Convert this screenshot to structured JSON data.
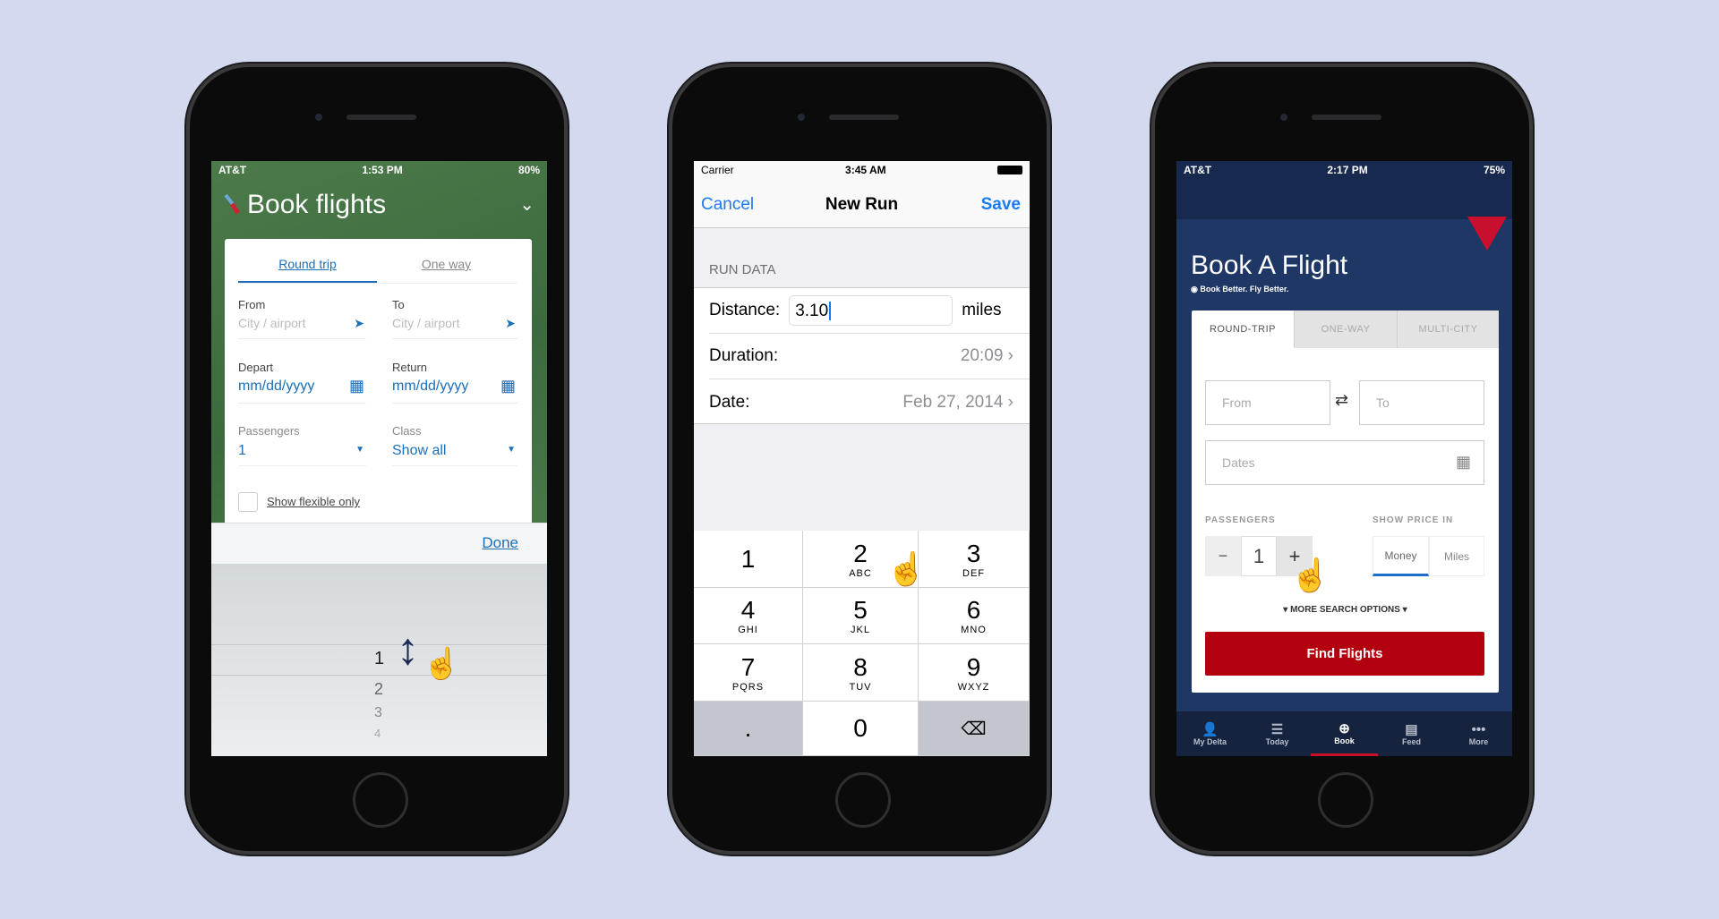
{
  "phone1": {
    "status": {
      "carrier": "AT&T",
      "time": "1:53 PM",
      "battery": "80%"
    },
    "title": "Book flights",
    "tabs": [
      {
        "label": "Round trip",
        "active": true
      },
      {
        "label": "One way",
        "active": false
      }
    ],
    "from": {
      "label": "From",
      "placeholder": "City / airport"
    },
    "to": {
      "label": "To",
      "placeholder": "City / airport"
    },
    "depart": {
      "label": "Depart",
      "value": "mm/dd/yyyy"
    },
    "return": {
      "label": "Return",
      "value": "mm/dd/yyyy"
    },
    "passengers": {
      "label": "Passengers",
      "value": "1"
    },
    "class": {
      "label": "Class",
      "value": "Show all"
    },
    "flexible": {
      "label": "Show flexible only",
      "checked": false
    },
    "done": "Done",
    "picker": [
      "1",
      "2",
      "3",
      "4"
    ]
  },
  "phone2": {
    "status": {
      "carrier": "Carrier",
      "time": "3:45 AM"
    },
    "nav": {
      "cancel": "Cancel",
      "title": "New Run",
      "save": "Save"
    },
    "section": "RUN DATA",
    "distance": {
      "label": "Distance:",
      "value": "3.10",
      "unit": "miles"
    },
    "duration": {
      "label": "Duration:",
      "value": "20:09"
    },
    "date": {
      "label": "Date:",
      "value": "Feb 27, 2014"
    },
    "keys": [
      {
        "n": "1",
        "l": ""
      },
      {
        "n": "2",
        "l": "ABC"
      },
      {
        "n": "3",
        "l": "DEF"
      },
      {
        "n": "4",
        "l": "GHI"
      },
      {
        "n": "5",
        "l": "JKL"
      },
      {
        "n": "6",
        "l": "MNO"
      },
      {
        "n": "7",
        "l": "PQRS"
      },
      {
        "n": "8",
        "l": "TUV"
      },
      {
        "n": "9",
        "l": "WXYZ"
      },
      {
        "n": ".",
        "l": ""
      },
      {
        "n": "0",
        "l": ""
      },
      {
        "n": "⌫",
        "l": ""
      }
    ]
  },
  "phone3": {
    "status": {
      "carrier": "AT&T",
      "time": "2:17 PM",
      "battery": "75%"
    },
    "title": "Book A Flight",
    "tagline": "Book Better. Fly Better.",
    "tabs": [
      {
        "label": "ROUND-TRIP",
        "active": true
      },
      {
        "label": "ONE-WAY",
        "active": false
      },
      {
        "label": "MULTI-CITY",
        "active": false
      }
    ],
    "from": "From",
    "to": "To",
    "dates": "Dates",
    "passengers": {
      "label": "PASSENGERS",
      "minus": "−",
      "value": "1",
      "plus": "+"
    },
    "price": {
      "label": "SHOW PRICE IN",
      "options": [
        "Money",
        "Miles"
      ],
      "selected": "Money"
    },
    "more": "▾ MORE SEARCH OPTIONS ▾",
    "find": "Find Flights",
    "nav": [
      {
        "label": "My Delta",
        "icon": "👤"
      },
      {
        "label": "Today",
        "icon": "☰"
      },
      {
        "label": "Book",
        "icon": "⊕",
        "active": true
      },
      {
        "label": "Feed",
        "icon": "▤"
      },
      {
        "label": "More",
        "icon": "•••"
      }
    ],
    "colors": {
      "navy": "#1e3765",
      "red": "#b3000f"
    }
  }
}
